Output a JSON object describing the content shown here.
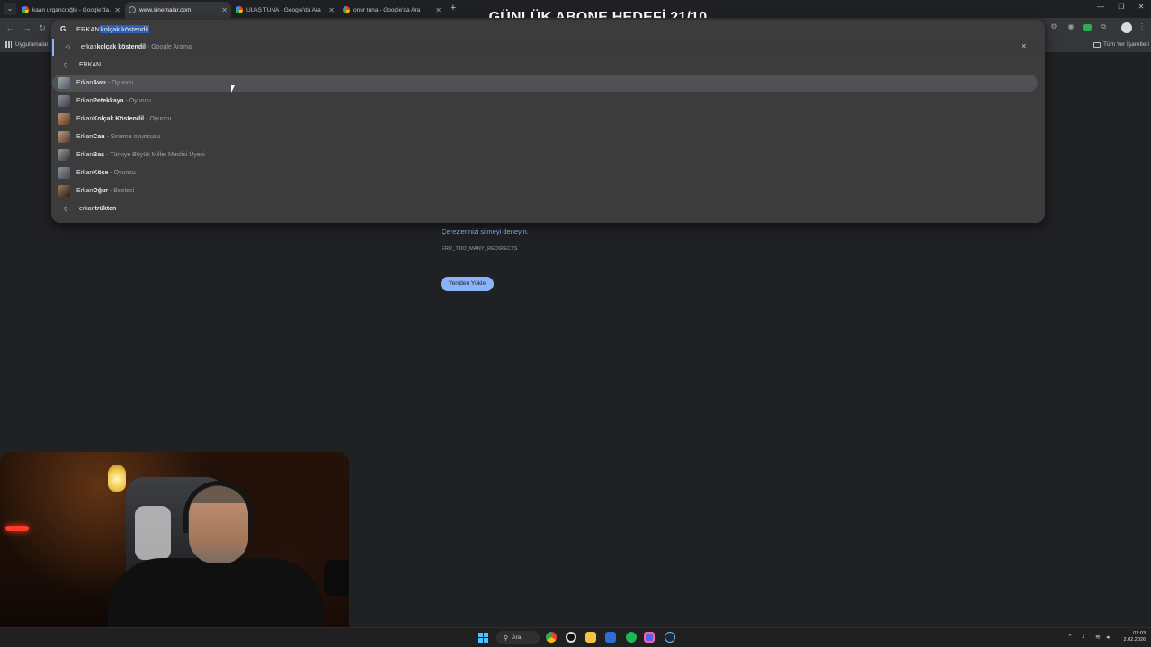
{
  "overlay": {
    "title": "GÜNLÜK ABONE HEDEFİ 21/10"
  },
  "tabs": [
    {
      "title": "kaan urgancıoğlu - Google'da Ar",
      "active": false,
      "favicon": "google-favicon"
    },
    {
      "title": "www.sinemalar.com",
      "active": true,
      "favicon": "globe-icon"
    },
    {
      "title": "ULAŞ TUNA - Google'da Ara",
      "active": false,
      "favicon": "google-favicon"
    },
    {
      "title": "onur tuna - Google'da Ara",
      "active": false,
      "favicon": "google-favicon"
    }
  ],
  "bookmarks": {
    "apps": "Uygulamalar",
    "all": "Tüm Yer İşaretleri"
  },
  "omnibox": {
    "typed": "ERKAN",
    "autocomplete_selected": " kolçak köstendil",
    "suggestions": [
      {
        "icon": "history-icon",
        "prefix": "erkan ",
        "bold": "kolçak köstendil",
        "desc": "Google Arama"
      },
      {
        "icon": "search-icon",
        "prefix": "ERKAN",
        "bold": "",
        "desc": ""
      },
      {
        "icon": "person-thumb",
        "prefix": "Erkan ",
        "bold": "Avcı",
        "desc": "Oyuncu"
      },
      {
        "icon": "person-thumb",
        "prefix": "Erkan ",
        "bold": "Petekkaya",
        "desc": "Oyuncu"
      },
      {
        "icon": "person-thumb",
        "prefix": "Erkan ",
        "bold": "Kolçak Köstendil",
        "desc": "Oyuncu"
      },
      {
        "icon": "person-thumb",
        "prefix": "Erkan ",
        "bold": "Can",
        "desc": "Sinema oyuncusu"
      },
      {
        "icon": "person-thumb",
        "prefix": "Erkan ",
        "bold": "Baş",
        "desc": "Türkiye Büyük Millet Meclisi Üyesi"
      },
      {
        "icon": "person-thumb",
        "prefix": "Erkan ",
        "bold": "Köse",
        "desc": "Oyuncu"
      },
      {
        "icon": "person-thumb",
        "prefix": "Erkan ",
        "bold": "Oğur",
        "desc": "Besteci"
      },
      {
        "icon": "search-icon",
        "prefix": "erkan ",
        "bold": "trükten",
        "desc": ""
      }
    ]
  },
  "error_page": {
    "link": "Çerezlerinizi silmeyi deneyin.",
    "code": "ERR_TOO_MANY_REDIRECTS",
    "reload_button": "Yeniden Yükle"
  },
  "taskbar": {
    "search_label": "Ara",
    "time": "01:03",
    "date": "2.02.2026"
  },
  "colors": {
    "accent": "#8ab4f8",
    "background": "#202124",
    "dropdown": "#3c3c3c"
  }
}
